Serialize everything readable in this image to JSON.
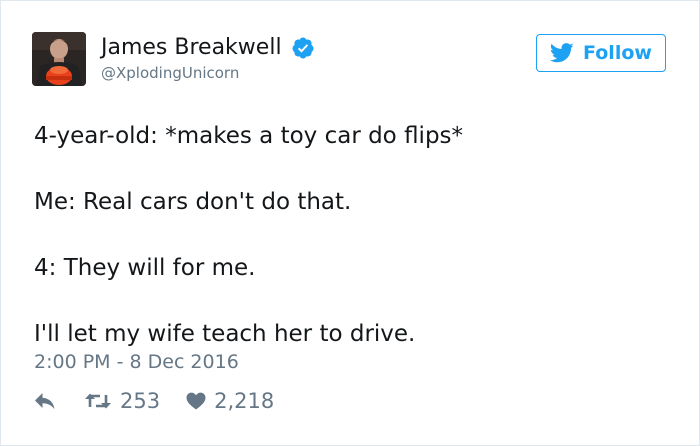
{
  "user": {
    "name": "James Breakwell",
    "handle": "@XplodingUnicorn"
  },
  "follow_label": "Follow",
  "tweet": {
    "lines": [
      "4-year-old: *makes a toy car do flips*",
      "Me: Real cars don't do that.",
      "4: They will for me.",
      "I'll let my wife teach her to drive."
    ]
  },
  "timestamp": "2:00 PM - 8 Dec 2016",
  "actions": {
    "retweet_count": "253",
    "like_count": "2,218"
  },
  "colors": {
    "accent": "#1da1f2",
    "secondary_text": "#657786",
    "primary_text": "#14171a",
    "border": "#e1e8ed"
  },
  "icons": [
    "verified-badge-icon",
    "twitter-bird-icon",
    "reply-icon",
    "retweet-icon",
    "heart-icon"
  ]
}
